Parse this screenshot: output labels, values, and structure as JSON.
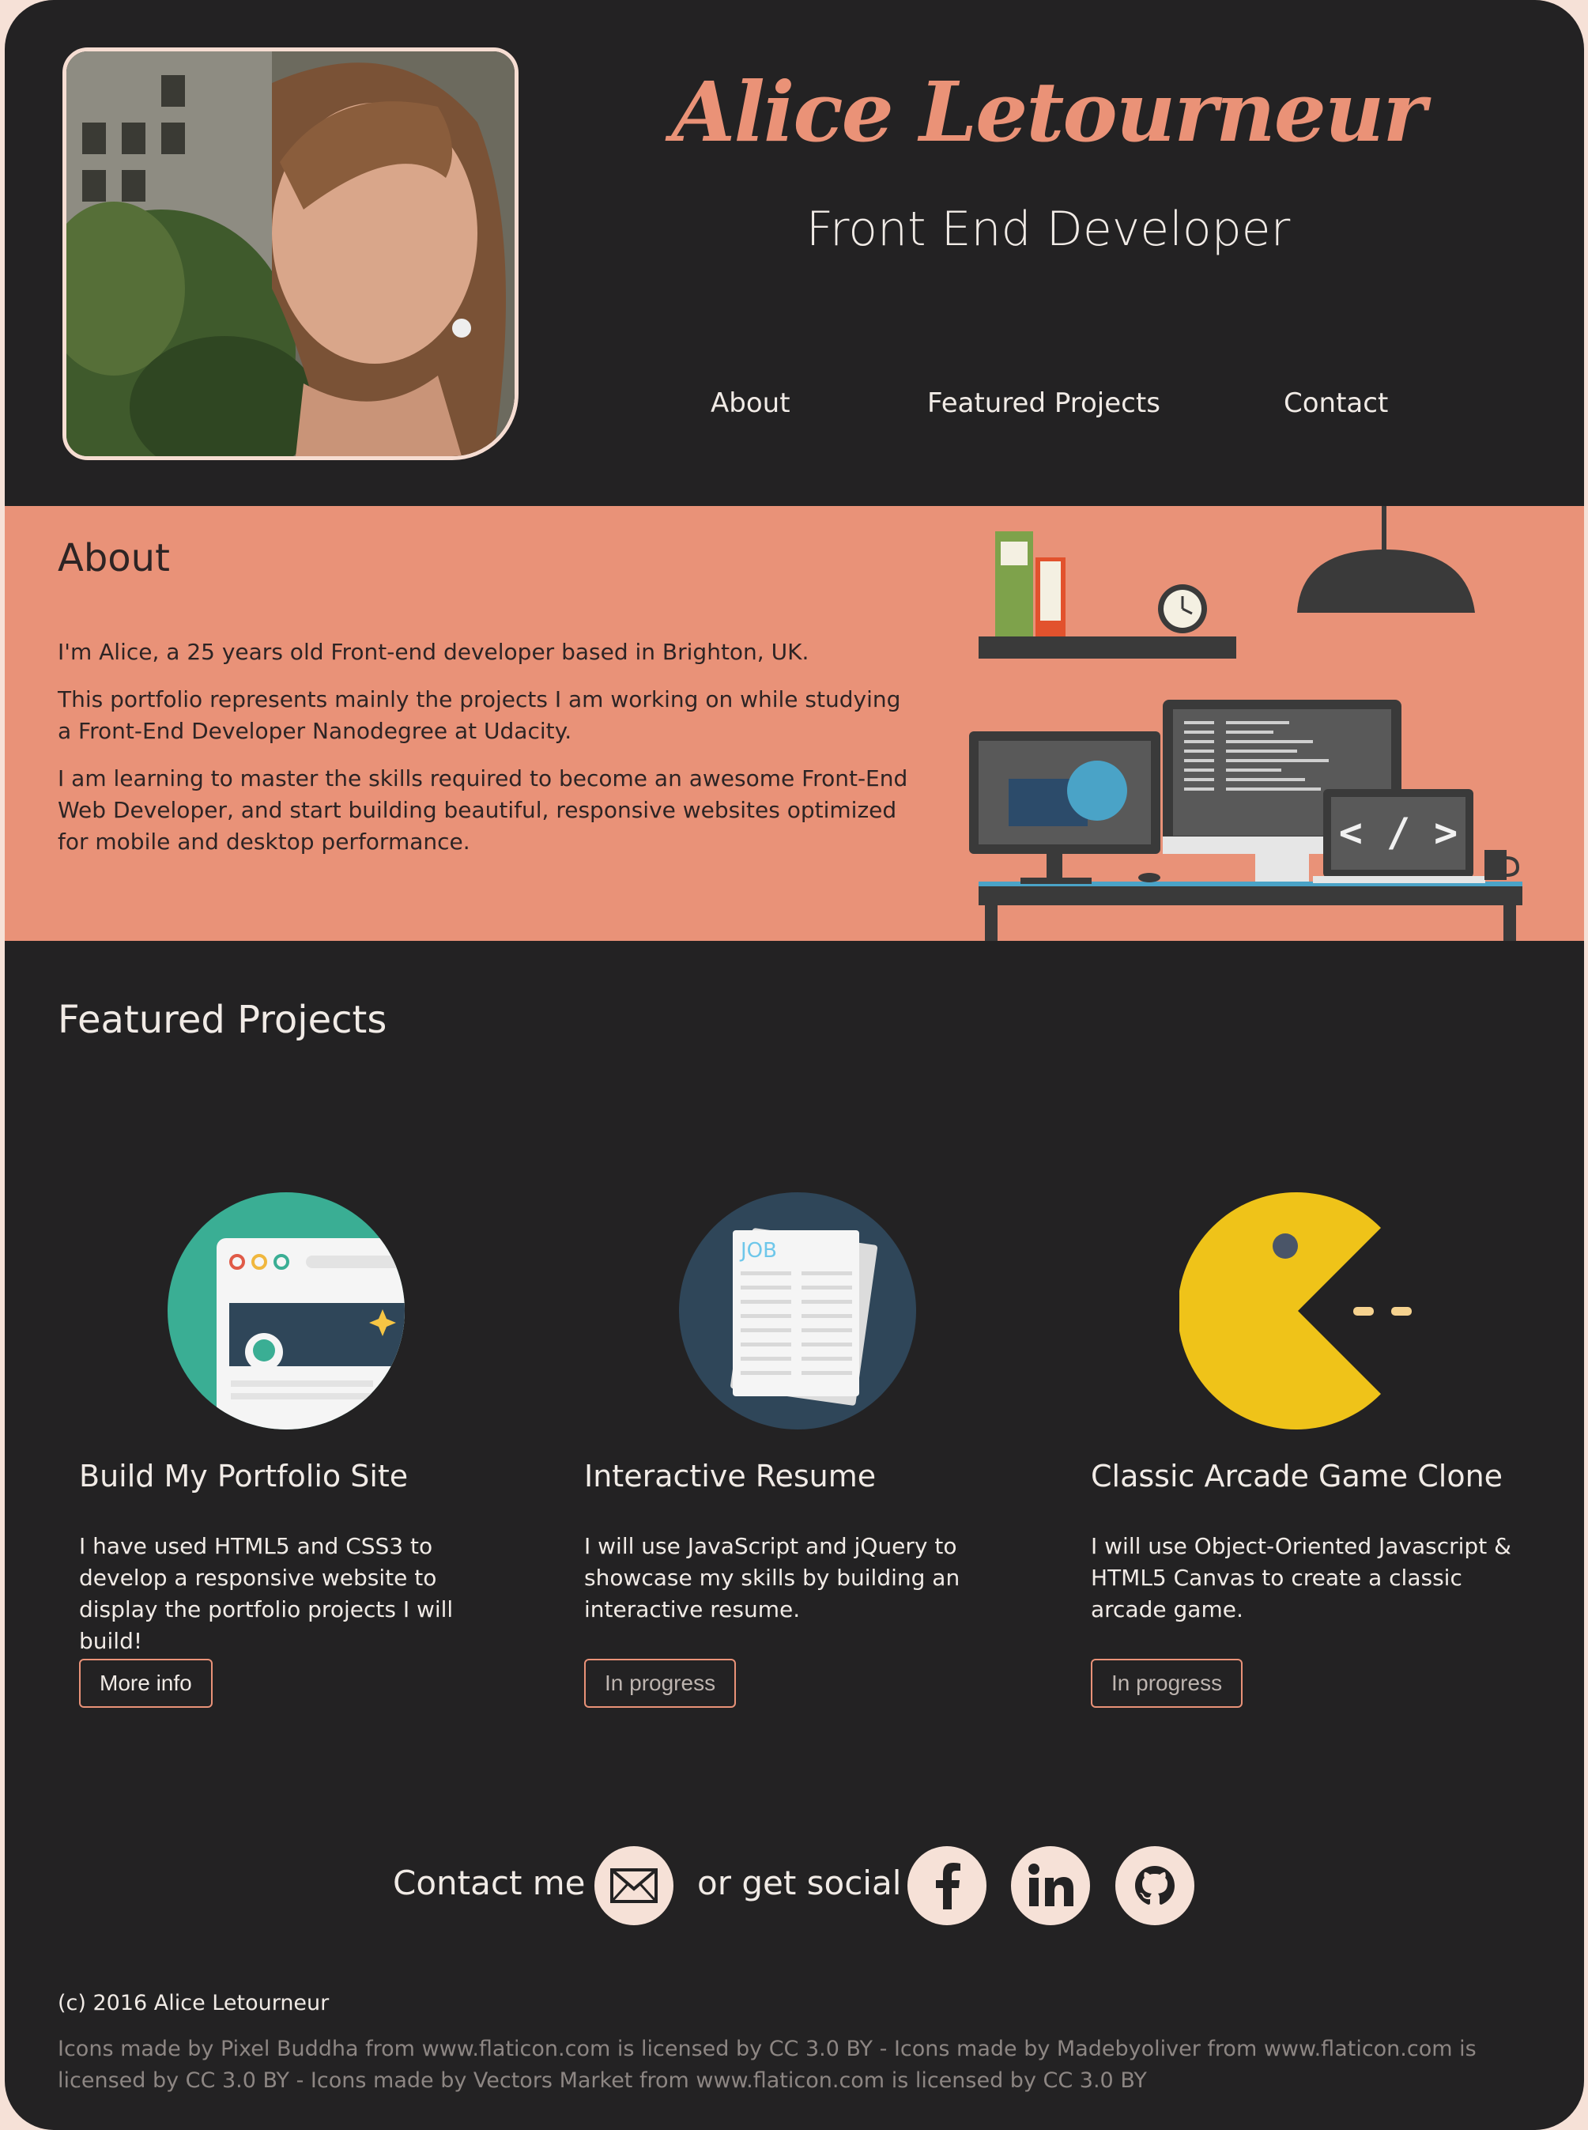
{
  "header": {
    "name": "Alice Letourneur",
    "role": "Front End Developer",
    "nav": [
      "About",
      "Featured Projects",
      "Contact"
    ]
  },
  "about": {
    "title": "About",
    "paragraphs": [
      "I'm Alice, a 25 years old Front-end developer based in Brighton, UK.",
      "This portfolio represents mainly the projects I am working on while studying a Front-End Developer Nanodegree at Udacity.",
      "I am learning to master the skills required to become an awesome Front-End Web Developer, and start building beautiful, responsive websites optimized for mobile and desktop performance."
    ],
    "code_glyph": "< / >"
  },
  "projects": {
    "title": "Featured Projects",
    "items": [
      {
        "title": "Build My Portfolio Site",
        "description": "I have used HTML5 and CSS3 to develop a responsive website to display the portfolio projects I will build!",
        "button": "More info",
        "icon": "browser-window-icon"
      },
      {
        "title": "Interactive Resume",
        "description": "I will use JavaScript and jQuery to showcase my skills by building an interactive resume.",
        "button": "In progress",
        "icon": "job-document-icon"
      },
      {
        "title": "Classic Arcade Game Clone",
        "description": "I will use Object-Oriented Javascript & HTML5 Canvas to create a classic arcade game.",
        "button": "In progress",
        "icon": "pacman-icon"
      }
    ],
    "job_label": "JOB"
  },
  "contact": {
    "label": "Contact me",
    "social_label": "or get social",
    "icons": [
      "mail-icon",
      "facebook-icon",
      "linkedin-icon",
      "github-icon"
    ]
  },
  "footer": {
    "copyright": "(c) 2016 Alice Letourneur",
    "credits": "Icons made by Pixel Buddha from www.flaticon.com is licensed by CC 3.0 BY - Icons made by Madebyoliver from www.flaticon.com is licensed by CC 3.0 BY - Icons made by Vectors Market from www.flaticon.com is licensed by CC 3.0 BY"
  },
  "colors": {
    "background": "#232223",
    "accent": "#e99278",
    "text": "#f1ebe6",
    "social_circle": "#f6e1d7",
    "pacman": "#efc319"
  }
}
